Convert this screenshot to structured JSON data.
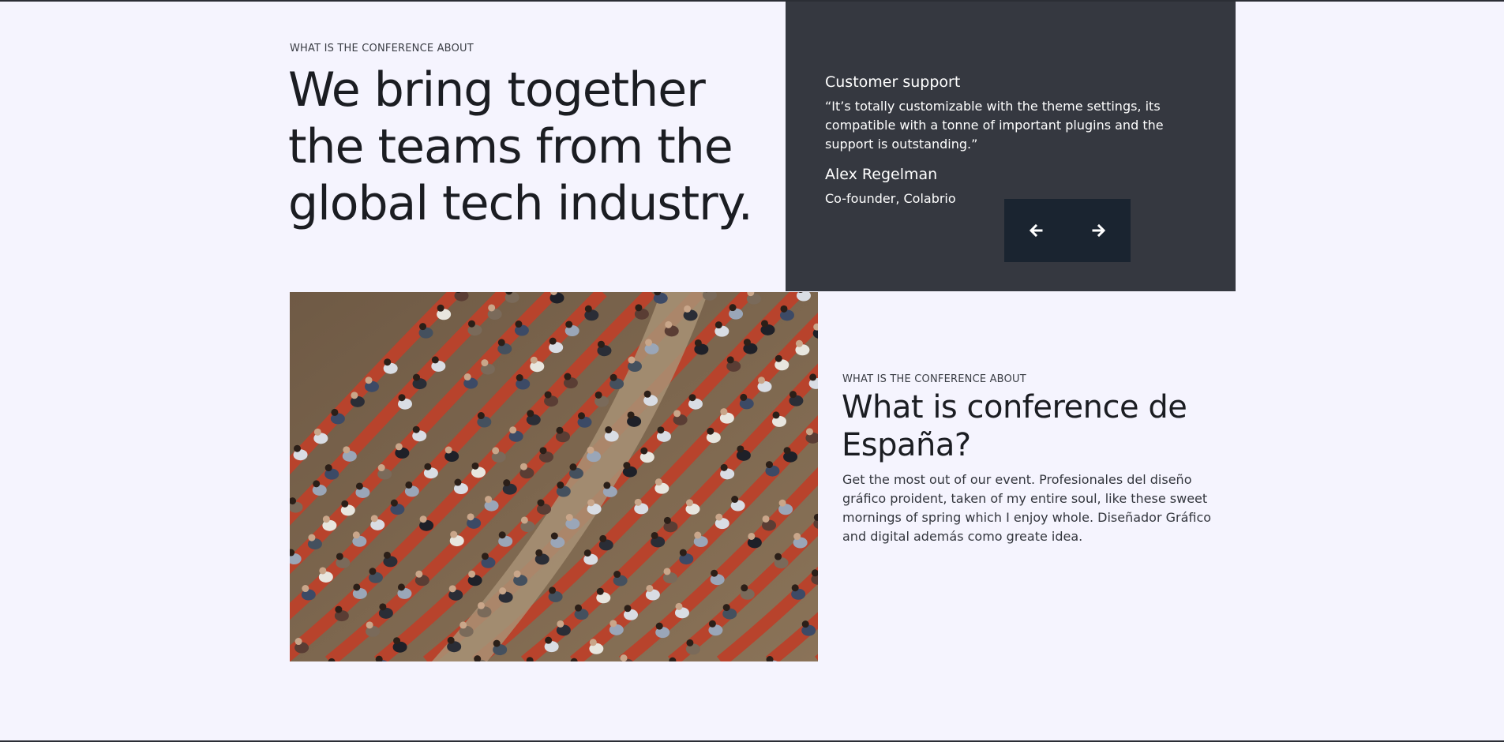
{
  "intro": {
    "eyebrow": "WHAT IS THE CONFERENCE ABOUT",
    "headline": "We bring together the teams from the global tech industry."
  },
  "testimonial": {
    "title": "Customer support",
    "quote": "“It’s totally customizable with the theme settings, its compatible with a tonne of important plugins and the support is outstanding.”",
    "name": "Alex Regelman",
    "role": "Co-founder, Colabrio",
    "prev_icon": "arrow-left-icon",
    "next_icon": "arrow-right-icon"
  },
  "about": {
    "eyebrow": "WHAT IS THE CONFERENCE ABOUT",
    "heading": "What is conference de España?",
    "body": "Get the most out of our event. Profesionales del diseño gráfico proident, taken of my entire soul, like these sweet mornings of spring which I enjoy whole. Diseñador Gráfico and digital además como greate idea."
  },
  "colors": {
    "page_bg": "#f5f4fe",
    "testimonial_bg": "#353840",
    "nav_bg": "#1a2430",
    "heading": "#1b1d22"
  }
}
